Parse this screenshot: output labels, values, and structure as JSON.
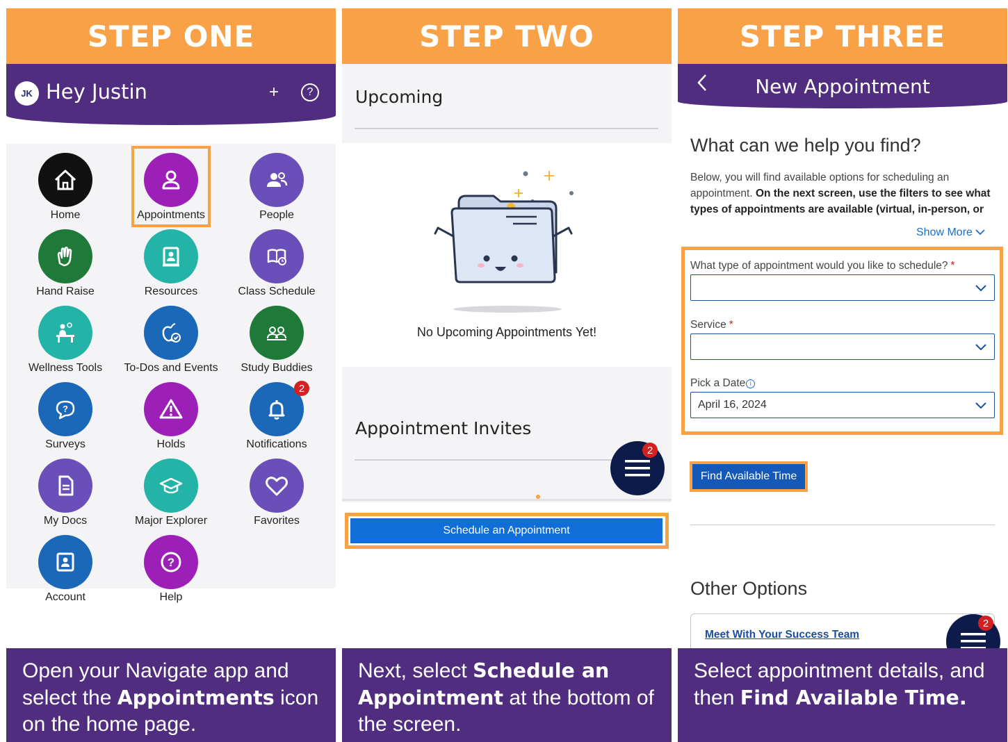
{
  "colors": {
    "step_orange": "#f9a146",
    "brand_purple": "#502d7f",
    "primary_blue": "#0f6ed8",
    "fab_navy": "#0d1b4a",
    "badge_red": "#d42020"
  },
  "step1": {
    "heading": "STEP ONE",
    "header": {
      "avatar_initials": "JK",
      "greeting": "Hey Justin",
      "plus_label": "+",
      "help_label": "?"
    },
    "tiles": [
      {
        "label": "Home",
        "icon": "home-icon",
        "color": "#111111"
      },
      {
        "label": "Appointments",
        "icon": "person-icon",
        "color": "#9c1fb8"
      },
      {
        "label": "People",
        "icon": "people-icon",
        "color": "#6a4fb8"
      },
      {
        "label": "Hand Raise",
        "icon": "hand-raise-icon",
        "color": "#1f7a3a"
      },
      {
        "label": "Resources",
        "icon": "resources-icon",
        "color": "#23b3a7"
      },
      {
        "label": "Class Schedule",
        "icon": "class-schedule-icon",
        "color": "#6a4fb8"
      },
      {
        "label": "Wellness Tools",
        "icon": "wellness-icon",
        "color": "#23b3a7"
      },
      {
        "label": "To-Dos and Events",
        "icon": "todo-apple-icon",
        "color": "#1b67b8"
      },
      {
        "label": "Study Buddies",
        "icon": "study-buddies-icon",
        "color": "#1f7a3a"
      },
      {
        "label": "Surveys",
        "icon": "surveys-icon",
        "color": "#1b67b8"
      },
      {
        "label": "Holds",
        "icon": "warning-icon",
        "color": "#9c1fb8"
      },
      {
        "label": "Notifications",
        "icon": "bell-icon",
        "color": "#1b67b8",
        "badge": "2"
      },
      {
        "label": "My Docs",
        "icon": "document-icon",
        "color": "#6a4fb8"
      },
      {
        "label": "Major Explorer",
        "icon": "graduation-cap-icon",
        "color": "#23b3a7"
      },
      {
        "label": "Favorites",
        "icon": "heart-icon",
        "color": "#6a4fb8"
      },
      {
        "label": "Account",
        "icon": "account-icon",
        "color": "#1b67b8"
      },
      {
        "label": "Help",
        "icon": "help-icon",
        "color": "#9c1fb8"
      }
    ],
    "caption": {
      "part1": "Open your Navigate app and select the ",
      "bold": "Appointments",
      "part2": " icon on the home page."
    }
  },
  "step2": {
    "heading": "STEP TWO",
    "upcoming_title": "Upcoming",
    "empty_message": "No Upcoming Appointments Yet!",
    "invites_title": "Appointment Invites",
    "fab_badge": "2",
    "schedule_button": "Schedule an Appointment",
    "caption": {
      "part1": "Next, select ",
      "bold": "Schedule an Appointment",
      "part2": " at the bottom of the screen."
    }
  },
  "step3": {
    "heading": "STEP THREE",
    "header_title": "New Appointment",
    "question": "What can we help you find?",
    "description_part1": "Below, you will find available options for scheduling an appointment. ",
    "description_bold": "On the next screen, use the filters to see what types of appointments are available (virtual, in-person, or",
    "show_more": "Show More",
    "form": {
      "type_label": "What type of appointment would you like to schedule?",
      "type_value": "",
      "service_label": "Service",
      "service_value": "",
      "required_mark": "*",
      "date_label": "Pick a Date",
      "date_value": "April 16, 2024"
    },
    "find_button": "Find Available Time",
    "other_options_title": "Other Options",
    "success_link": "Meet With Your Success Team",
    "fab_badge": "2",
    "caption": {
      "part1": "Select appointment details, and then ",
      "bold": "Find Available Time."
    }
  }
}
